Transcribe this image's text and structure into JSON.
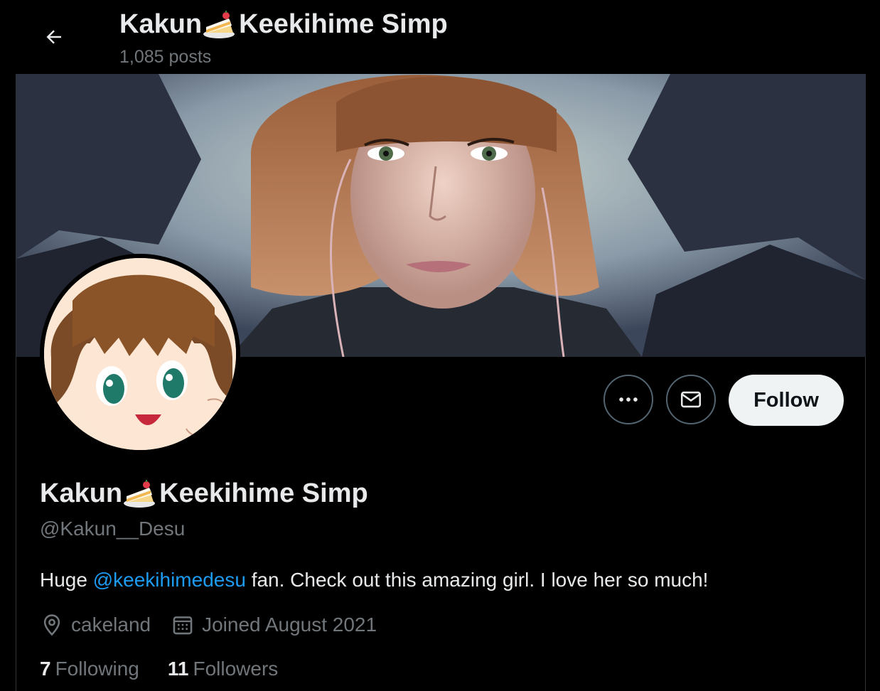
{
  "header": {
    "name_part1": "Kakun",
    "name_part2": "Keekihime Simp",
    "posts_count": "1,085 posts"
  },
  "profile": {
    "name_part1": "Kakun",
    "name_part2": "Keekihime Simp",
    "handle": "@Kakun__Desu",
    "bio_before": "Huge ",
    "bio_mention": "@keekihimedesu",
    "bio_after": " fan. Check out this amazing girl. I love her so much!",
    "location": "cakeland",
    "joined": "Joined August 2021",
    "following_count": "7",
    "following_label": "Following",
    "followers_count": "11",
    "followers_label": "Followers"
  },
  "actions": {
    "follow_label": "Follow"
  },
  "icons": {
    "back": "arrow-left-icon",
    "more": "ellipsis-icon",
    "message": "envelope-icon",
    "location": "map-pin-icon",
    "calendar": "calendar-icon",
    "emoji": "cake-icon"
  },
  "colors": {
    "background": "#000000",
    "text": "#e7e9ea",
    "muted": "#71767b",
    "link": "#1d9bf0",
    "follow_button": "#eff3f4"
  }
}
